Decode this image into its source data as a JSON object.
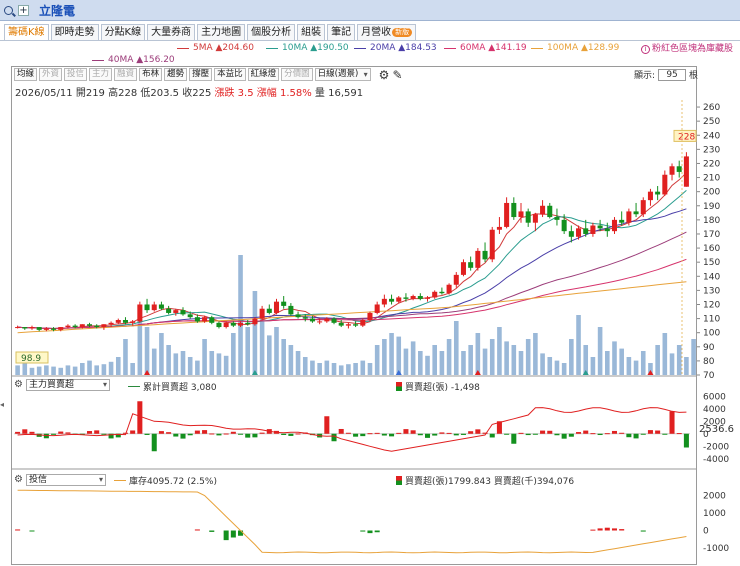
{
  "window": {
    "title": "立隆電",
    "new_tab_icon": "+"
  },
  "tabs": [
    {
      "label": "籌碼K線",
      "active": true
    },
    {
      "label": "即時走勢"
    },
    {
      "label": "分點K線"
    },
    {
      "label": "大量券商"
    },
    {
      "label": "主力地圖"
    },
    {
      "label": "個股分析"
    },
    {
      "label": "組裝"
    },
    {
      "label": "筆記"
    },
    {
      "label": "月營收",
      "badge": "新版"
    }
  ],
  "ma_legend": [
    {
      "text": "5MA ▲204.60",
      "color": "#d13b3b"
    },
    {
      "text": "10MA ▲190.50",
      "color": "#2a9d8f"
    },
    {
      "text": "20MA ▲184.53",
      "color": "#4a3fa8"
    },
    {
      "text": "60MA ▲141.19",
      "color": "#d6336c"
    },
    {
      "text": "100MA ▲128.99",
      "color": "#e8a23a"
    },
    {
      "text": "40MA ▲156.20",
      "color": "#9c3d7a"
    }
  ],
  "hint": "粉紅色區塊為庫藏股",
  "toolbar": {
    "buttons": [
      "均線",
      "外資",
      "投信",
      "主力",
      "融資",
      "布林",
      "趨勢",
      "撐壓",
      "本益比",
      "紅綠燈",
      "分價圖"
    ],
    "disabled": [
      1,
      2,
      3,
      4,
      10
    ],
    "period": "日線(週景)",
    "show_label": "顯示:",
    "show_value": "95",
    "show_unit": "根"
  },
  "info": {
    "date": "2026/05/11",
    "open_label": "開",
    "open": "219",
    "high_label": "高",
    "high": "228",
    "low_label": "低",
    "low": "203.5",
    "close_label": "收",
    "close": "225",
    "change": "漲跌 3.5",
    "pct": "漲幅 1.58%",
    "volume": "量 16,591"
  },
  "panel2": {
    "indicator": "主力買賣超",
    "legend_line": "累計買賣超 3,080",
    "legend_bar": "買賣超(張) -1,498",
    "current_tag": "2536.6"
  },
  "panel3": {
    "indicator": "投信",
    "legend_line": "庫存4095.72 (2.5%)",
    "legend_bar": "買賣超(張)1799.843 買賣超(千)394,076"
  },
  "chart_data": {
    "type": "candlestick",
    "y_ticks_price": [
      70,
      80,
      90,
      100,
      110,
      120,
      130,
      140,
      150,
      160,
      170,
      180,
      190,
      200,
      210,
      220,
      230,
      240,
      250,
      260
    ],
    "price_ylim": [
      70,
      265
    ],
    "last_price_tag": "228",
    "low_marker": "98.9",
    "colors": {
      "up": "#e02020",
      "down": "#13901e",
      "volume": "#9ab8d8",
      "tag_bg": "#fff3c4"
    },
    "candles": [
      [
        104,
        105,
        103,
        104
      ],
      [
        104,
        104,
        102,
        103
      ],
      [
        103,
        105,
        102,
        104
      ],
      [
        104,
        104,
        101,
        102
      ],
      [
        102,
        104,
        101,
        103
      ],
      [
        103,
        104,
        101,
        102
      ],
      [
        102,
        104,
        101,
        104
      ],
      [
        104,
        106,
        103,
        105
      ],
      [
        105,
        106,
        103,
        104
      ],
      [
        104,
        106,
        103,
        106
      ],
      [
        106,
        107,
        104,
        105
      ],
      [
        105,
        106,
        103,
        104
      ],
      [
        104,
        106,
        102,
        106
      ],
      [
        106,
        108,
        104,
        107
      ],
      [
        107,
        110,
        106,
        109
      ],
      [
        109,
        111,
        106,
        107
      ],
      [
        107,
        109,
        105,
        108
      ],
      [
        108,
        122,
        107,
        120
      ],
      [
        120,
        124,
        114,
        116
      ],
      [
        116,
        122,
        115,
        120
      ],
      [
        120,
        122,
        116,
        117
      ],
      [
        117,
        119,
        113,
        114
      ],
      [
        114,
        117,
        112,
        116
      ],
      [
        116,
        118,
        112,
        113
      ],
      [
        113,
        115,
        110,
        111
      ],
      [
        111,
        113,
        107,
        108
      ],
      [
        108,
        112,
        107,
        111
      ],
      [
        111,
        112,
        106,
        107
      ],
      [
        107,
        108,
        103,
        104
      ],
      [
        104,
        108,
        103,
        107
      ],
      [
        107,
        108,
        104,
        105
      ],
      [
        105,
        108,
        104,
        107
      ],
      [
        107,
        109,
        105,
        106
      ],
      [
        106,
        111,
        105,
        110
      ],
      [
        110,
        119,
        109,
        117
      ],
      [
        117,
        120,
        113,
        114
      ],
      [
        114,
        124,
        113,
        122
      ],
      [
        122,
        126,
        117,
        119
      ],
      [
        119,
        121,
        112,
        113
      ],
      [
        113,
        115,
        110,
        111
      ],
      [
        111,
        113,
        108,
        110
      ],
      [
        110,
        112,
        107,
        108
      ],
      [
        108,
        110,
        106,
        108
      ],
      [
        108,
        111,
        107,
        110
      ],
      [
        110,
        111,
        106,
        107
      ],
      [
        107,
        109,
        104,
        105
      ],
      [
        105,
        107,
        103,
        106
      ],
      [
        106,
        108,
        104,
        105
      ],
      [
        105,
        110,
        104,
        109
      ],
      [
        109,
        115,
        108,
        114
      ],
      [
        114,
        122,
        113,
        120
      ],
      [
        120,
        127,
        118,
        124
      ],
      [
        124,
        127,
        120,
        122
      ],
      [
        122,
        126,
        121,
        125
      ],
      [
        125,
        128,
        122,
        124
      ],
      [
        124,
        127,
        123,
        126
      ],
      [
        126,
        128,
        123,
        124
      ],
      [
        124,
        126,
        122,
        125
      ],
      [
        125,
        130,
        124,
        129
      ],
      [
        129,
        132,
        127,
        128
      ],
      [
        128,
        135,
        127,
        134
      ],
      [
        134,
        143,
        132,
        141
      ],
      [
        141,
        152,
        140,
        150
      ],
      [
        150,
        154,
        144,
        146
      ],
      [
        146,
        160,
        144,
        158
      ],
      [
        158,
        164,
        150,
        152
      ],
      [
        152,
        175,
        150,
        173
      ],
      [
        173,
        182,
        170,
        175
      ],
      [
        175,
        196,
        174,
        192
      ],
      [
        192,
        196,
        180,
        182
      ],
      [
        182,
        192,
        178,
        186
      ],
      [
        186,
        188,
        175,
        178
      ],
      [
        178,
        185,
        172,
        184
      ],
      [
        184,
        194,
        182,
        190
      ],
      [
        190,
        192,
        181,
        182
      ],
      [
        182,
        188,
        176,
        180
      ],
      [
        180,
        184,
        170,
        172
      ],
      [
        172,
        176,
        164,
        168
      ],
      [
        168,
        176,
        166,
        174
      ],
      [
        174,
        180,
        168,
        170
      ],
      [
        170,
        178,
        168,
        176
      ],
      [
        176,
        180,
        172,
        174
      ],
      [
        174,
        178,
        168,
        172
      ],
      [
        172,
        182,
        170,
        180
      ],
      [
        180,
        186,
        176,
        178
      ],
      [
        178,
        188,
        176,
        186
      ],
      [
        186,
        192,
        182,
        184
      ],
      [
        184,
        196,
        182,
        194
      ],
      [
        194,
        202,
        190,
        200
      ],
      [
        200,
        204,
        194,
        198
      ],
      [
        198,
        215,
        197,
        212
      ],
      [
        212,
        220,
        208,
        218
      ],
      [
        218,
        222,
        210,
        214
      ],
      [
        203.5,
        228,
        203.5,
        225
      ]
    ],
    "volume_rel": [
      0.08,
      0.1,
      0.06,
      0.07,
      0.08,
      0.07,
      0.06,
      0.08,
      0.07,
      0.1,
      0.12,
      0.08,
      0.09,
      0.11,
      0.15,
      0.3,
      0.1,
      0.55,
      0.4,
      0.22,
      0.35,
      0.25,
      0.18,
      0.2,
      0.15,
      0.12,
      0.3,
      0.2,
      0.18,
      0.16,
      0.35,
      1.0,
      0.4,
      0.7,
      0.5,
      0.33,
      0.4,
      0.3,
      0.25,
      0.2,
      0.15,
      0.12,
      0.1,
      0.12,
      0.1,
      0.08,
      0.09,
      0.1,
      0.12,
      0.1,
      0.25,
      0.3,
      0.35,
      0.32,
      0.22,
      0.28,
      0.2,
      0.16,
      0.25,
      0.2,
      0.3,
      0.45,
      0.2,
      0.25,
      0.35,
      0.22,
      0.3,
      0.4,
      0.28,
      0.25,
      0.2,
      0.3,
      0.35,
      0.18,
      0.15,
      0.12,
      0.1,
      0.3,
      0.5,
      0.25,
      0.15,
      0.4,
      0.2,
      0.28,
      0.22,
      0.15,
      0.12,
      0.2,
      0.1,
      0.25,
      0.35,
      0.18,
      0.25,
      0.15,
      0.3
    ],
    "panel2_ylim": [
      -5000,
      7000
    ],
    "panel2_ticks": [
      -4000,
      -2000,
      0,
      2000,
      4000,
      6000
    ],
    "panel3_ylim": [
      -1800,
      2600
    ],
    "panel3_ticks": [
      -1000,
      0,
      1000,
      2000
    ]
  }
}
